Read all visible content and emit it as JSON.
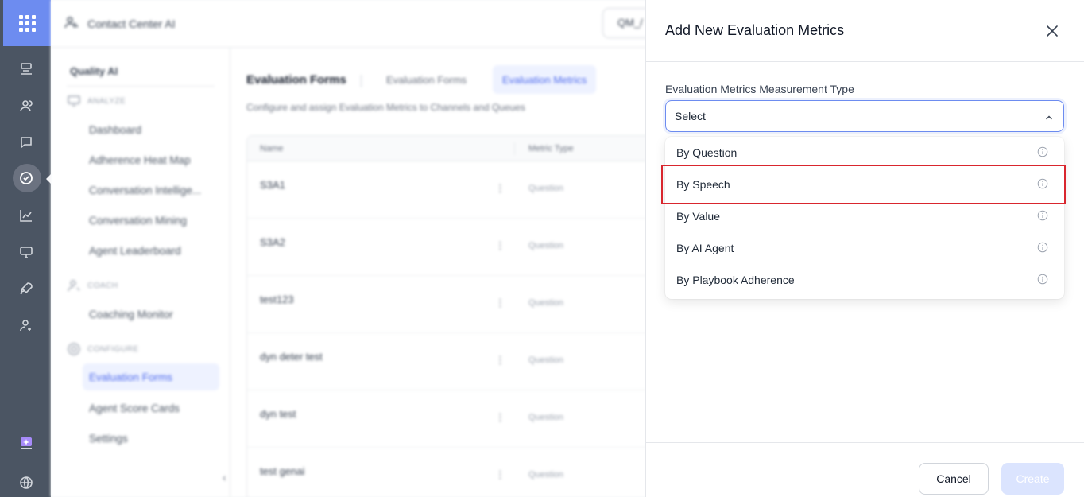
{
  "app": {
    "title": "Contact Center AI",
    "qm_select_value": "QM_/"
  },
  "sidebar": {
    "heading": "Quality AI",
    "sections": {
      "analyze": "ANALYZE",
      "coach": "COACH",
      "configure": "CONFIGURE"
    },
    "items": {
      "dashboard": "Dashboard",
      "adherence_heat_map": "Adherence Heat Map",
      "conversation_intelligence": "Conversation Intellige...",
      "conversation_mining": "Conversation Mining",
      "agent_leaderboard": "Agent Leaderboard",
      "coaching_monitor": "Coaching Monitor",
      "evaluation_forms": "Evaluation Forms",
      "agent_score_cards": "Agent Score Cards",
      "settings": "Settings"
    }
  },
  "content": {
    "title": "Evaluation Forms",
    "tabs": [
      "Evaluation Forms",
      "Evaluation Metrics"
    ],
    "active_tab": "Evaluation Metrics",
    "description": "Configure and assign Evaluation Metrics to Channels and Queues",
    "table": {
      "columns": [
        "Name",
        "Metric Type"
      ],
      "rows": [
        {
          "name": "S3A1",
          "type": "Question"
        },
        {
          "name": "S3A2",
          "type": "Question"
        },
        {
          "name": "test123",
          "type": "Question"
        },
        {
          "name": "dyn deter test",
          "type": "Question"
        },
        {
          "name": "dyn test",
          "type": "Question"
        },
        {
          "name": "test genai",
          "type": "Question"
        }
      ]
    }
  },
  "modal": {
    "title": "Add New Evaluation Metrics",
    "field_label": "Evaluation Metrics Measurement Type",
    "select_value": "Select",
    "options": [
      "By Question",
      "By Speech",
      "By Value",
      "By AI Agent",
      "By Playbook Adherence"
    ],
    "highlighted_option": "By Speech",
    "cancel_label": "Cancel",
    "create_label": "Create"
  },
  "colors": {
    "accent": "#4f6bed",
    "highlight_border": "#d9262e",
    "rail": "#4b5563",
    "create_disabled": "#dbe4fe"
  }
}
